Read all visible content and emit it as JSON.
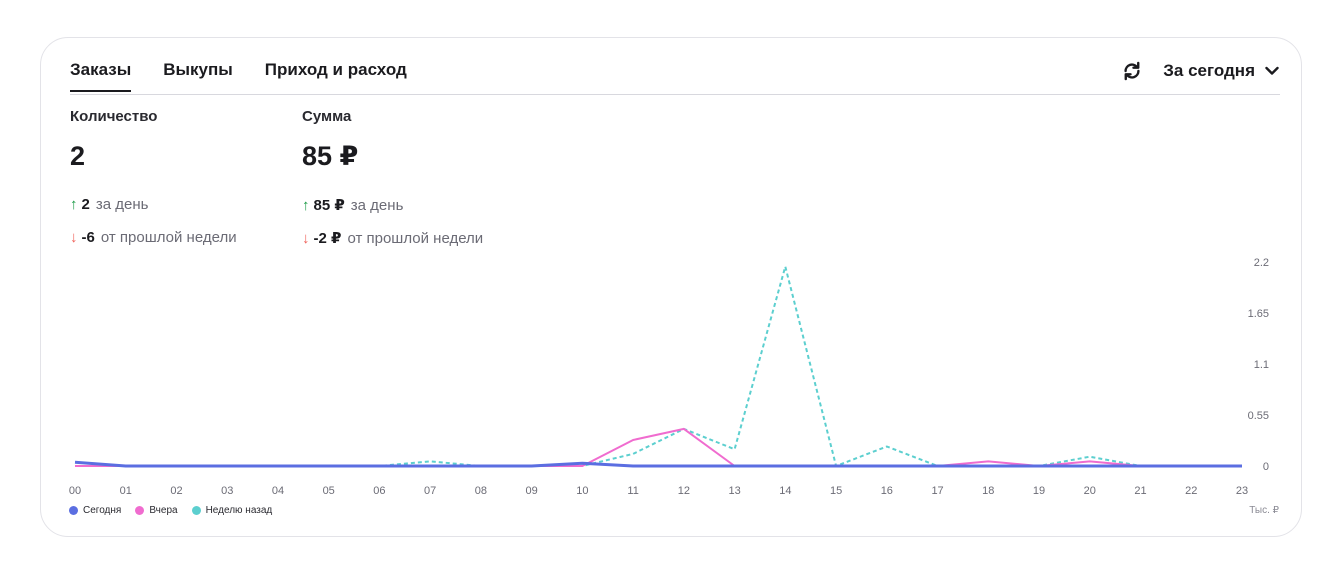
{
  "tabs": [
    "Заказы",
    "Выкупы",
    "Приход и расход"
  ],
  "period": {
    "label": "За сегодня"
  },
  "icons": {
    "refresh": "refresh-icon",
    "chevron": "chevron-down-icon",
    "arrow_up": "arrow-up-icon",
    "arrow_down": "arrow-down-icon"
  },
  "metrics": {
    "count": {
      "label": "Количество",
      "value": "2",
      "day_value": "2",
      "day_text": "за день",
      "week_value": "-6",
      "week_text": "от прошлой недели"
    },
    "sum": {
      "label": "Сумма",
      "value": "85 ₽",
      "day_value": "85 ₽",
      "day_text": "за день",
      "week_value": "-2 ₽",
      "week_text": "от прошлой недели"
    }
  },
  "colors": {
    "today": "#5b6ee1",
    "yesterday": "#f06ccf",
    "week_ago": "#5ccfcf",
    "up": "#1a9a45",
    "down": "#f0625a"
  },
  "chart_data": {
    "type": "line",
    "x": [
      "00",
      "01",
      "02",
      "03",
      "04",
      "05",
      "06",
      "07",
      "08",
      "09",
      "10",
      "11",
      "12",
      "13",
      "14",
      "15",
      "16",
      "17",
      "18",
      "19",
      "20",
      "21",
      "22",
      "23"
    ],
    "ylim": [
      0,
      2.2
    ],
    "yticks": [
      "2.2",
      "1.65",
      "1.1",
      "0.55",
      "0"
    ],
    "ylabel": "Тыс. ₽",
    "legend_position": "bottom-left",
    "grid": false,
    "series": [
      {
        "name": "Сегодня",
        "style": "solid",
        "values": [
          0.04,
          0,
          0,
          0,
          0,
          0,
          0,
          0,
          0,
          0,
          0.03,
          0,
          0,
          0,
          0,
          0,
          0,
          0,
          0,
          0,
          0,
          0,
          0,
          0
        ]
      },
      {
        "name": "Вчера",
        "style": "solid",
        "values": [
          0,
          0,
          0,
          0,
          0,
          0,
          0,
          0,
          0,
          0,
          0,
          0.28,
          0.4,
          0,
          0,
          0,
          0,
          0,
          0.05,
          0,
          0.05,
          0,
          0,
          0
        ]
      },
      {
        "name": "Неделю назад",
        "style": "dashed",
        "values": [
          0,
          0,
          0,
          0,
          0,
          0,
          0,
          0.05,
          0,
          0,
          0,
          0.13,
          0.4,
          0.18,
          2.15,
          0,
          0.21,
          0,
          0,
          0,
          0.1,
          0,
          0,
          0
        ]
      }
    ]
  }
}
